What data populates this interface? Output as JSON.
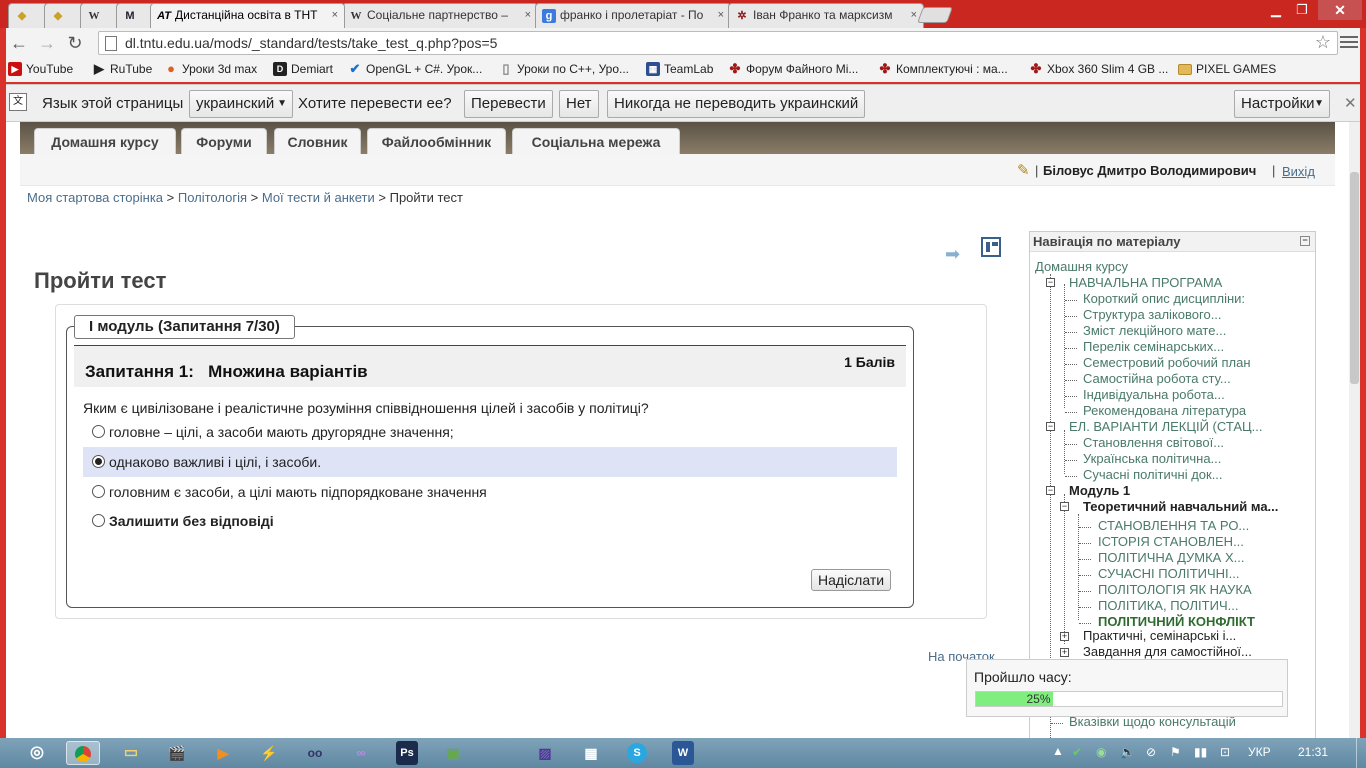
{
  "browser": {
    "tabs": [
      {
        "label": "",
        "icon": "shield-icon",
        "active": false
      },
      {
        "label": "",
        "icon": "shield-icon",
        "active": false
      },
      {
        "label": "W",
        "icon": "wikipedia-icon",
        "active": false
      },
      {
        "label": "M",
        "icon": "moodle-icon",
        "active": false
      },
      {
        "label": "Дистанційна освіта в ТНТ",
        "favicon": "AT",
        "active": true
      },
      {
        "label": "Соціальне партнерство –",
        "favicon": "W",
        "active": false
      },
      {
        "label": "франко і пролетаріат - По",
        "favicon": "g",
        "active": false
      },
      {
        "label": "Іван Франко та марксизм",
        "favicon": "✲",
        "active": false
      }
    ],
    "close_glyph": "×",
    "url": "dl.tntu.edu.ua/mods/_standard/tests/take_test_q.php?pos=5",
    "bookmarks": [
      {
        "label": "YouTube",
        "color": "#cc1010",
        "glyph": "▶"
      },
      {
        "label": "RuTube",
        "color": "#222222",
        "glyph": "▶"
      },
      {
        "label": "Уроки 3d max",
        "color": "#e06020",
        "glyph": "●"
      },
      {
        "label": "Demiart",
        "color": "#222222",
        "glyph": "D"
      },
      {
        "label": "OpenGL + C#. Урок...",
        "color": "#1a6fcf",
        "glyph": "✔"
      },
      {
        "label": "Уроки по C++, Уро...",
        "color": "#888888",
        "glyph": "▯"
      },
      {
        "label": "TeamLab",
        "color": "#2d4f8f",
        "glyph": "▦"
      },
      {
        "label": "Форум Файного Мі...",
        "color": "#a01818",
        "glyph": "✤"
      },
      {
        "label": "Комплектуючі : ма...",
        "color": "#a01818",
        "glyph": "✤"
      },
      {
        "label": "Xbox 360 Slim 4 GB ...",
        "color": "#a01818",
        "glyph": "✤"
      },
      {
        "label": "PIXEL GAMES",
        "color": "#d9a63a",
        "glyph": "▬"
      }
    ]
  },
  "translate": {
    "prompt": "Язык этой страницы",
    "language": "украинский",
    "question": "Хотите перевести ее?",
    "translate_btn": "Перевести",
    "no_btn": "Нет",
    "never_btn": "Никогда не переводить украинский",
    "settings_btn": "Настройки"
  },
  "site": {
    "tabs": [
      "Домашня курсу",
      "Форуми",
      "Словник",
      "Файлообмінник",
      "Соціальна мережа"
    ],
    "user_name": "Біловус Дмитро Володимирович",
    "logout": "Вихід",
    "breadcrumb": [
      "Моя стартова сторінка",
      "Політологія",
      "Мої тести й анкети",
      "Пройти тест"
    ],
    "page_title": "Пройти тест"
  },
  "quiz": {
    "legend": "I модуль (Запитання 7/30)",
    "question_title": "Запитання 1:   Множина варіантів",
    "points": "1 Балів",
    "question_text": "Яким є цивілізоване і реалістичне розуміння співвідношення цілей і засобів у політиці?",
    "options": [
      {
        "label": "головне – цілі, а засоби мають другорядне значення;",
        "selected": false
      },
      {
        "label": "однаково важливі і цілі, і засоби.",
        "selected": true
      },
      {
        "label": "головним є засоби, а цілі мають підпорядковане значення",
        "selected": false
      },
      {
        "label": "Залишити без відповіді",
        "selected": false
      }
    ],
    "submit": "Надіслати",
    "to_start": "На початок"
  },
  "nav": {
    "title": "Навігація по матеріалу",
    "collapse_glyph": "−",
    "items": [
      "Домашня курсу",
      "НАВЧАЛЬНА ПРОГРАМА",
      "Короткий опис дисципліни:",
      "Структура залікового...",
      "Зміст лекційного мате...",
      "Перелік семінарських...",
      "Семестровий робочий план",
      "Самостійна робота сту...",
      "Індивідуальна робота...",
      "Рекомендована література",
      "ЕЛ. ВАРІАНТИ ЛЕКЦІЙ (СТАЦ...",
      "Становлення світової...",
      "Українська політична...",
      "Сучасні політичні док...",
      "Модуль 1",
      "Теоретичний навчальний ма...",
      "СТАНОВЛЕННЯ ТА РО...",
      "ІСТОРІЯ СТАНОВЛЕН...",
      "ПОЛІТИЧНА ДУМКА Х...",
      "СУЧАСНІ ПОЛІТИЧНІ...",
      "ПОЛІТОЛОГІЯ ЯК НАУКА",
      "ПОЛІТИКА, ПОЛІТИЧ...",
      "ПОЛІТИЧНИЙ КОНФЛІКТ",
      "Практичні, семінарські і...",
      "Завдання для самостійної...",
      "Вказівки щодо консультацій"
    ]
  },
  "timer": {
    "label": "Пройшло часу:",
    "percent_text": "25%",
    "fraction": 0.25
  },
  "taskbar": {
    "language": "УКР",
    "time": "21:31"
  }
}
